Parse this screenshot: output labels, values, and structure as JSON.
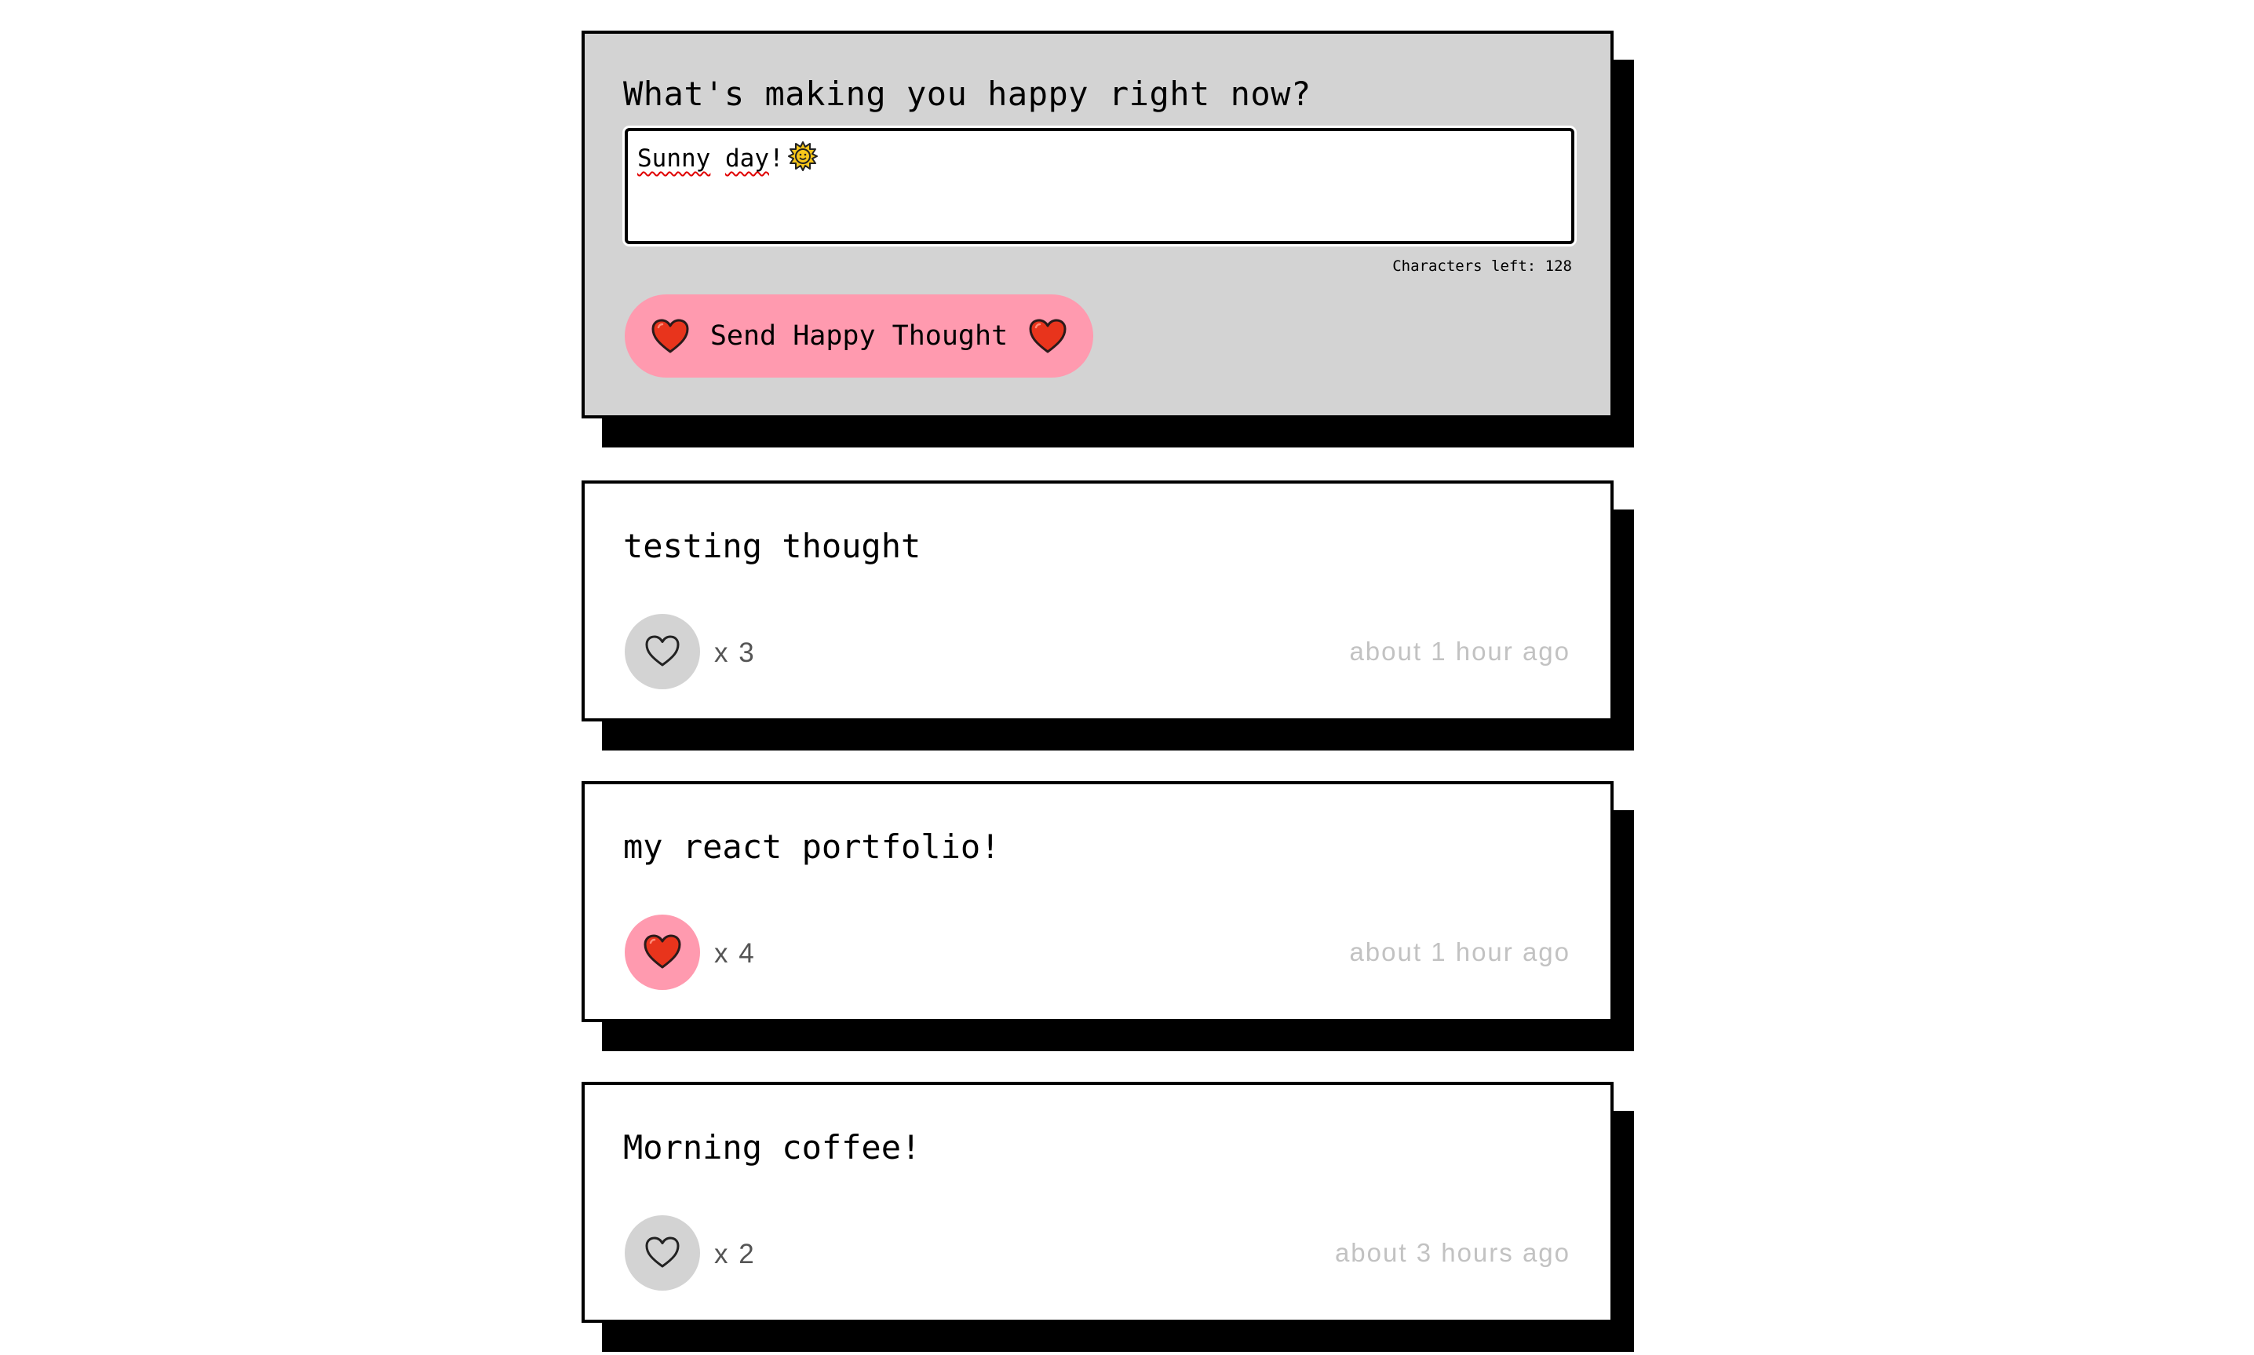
{
  "form": {
    "title": "What's making you happy right now?",
    "input_word1": "Sunny",
    "input_space": " ",
    "input_word2": "day",
    "input_bang": "!",
    "input_emoji_icon": "sun-icon",
    "characters_left_label": "Characters left: 128",
    "send_button_label": "Send Happy Thought",
    "send_button_icon": "heart-icon"
  },
  "thoughts": [
    {
      "message": "testing thought",
      "likes_label": "x 3",
      "likes": 3,
      "liked": false,
      "time": "about 1 hour ago"
    },
    {
      "message": "my react portfolio!",
      "likes_label": "x 4",
      "likes": 4,
      "liked": true,
      "time": "about 1 hour ago"
    },
    {
      "message": "Morning coffee!",
      "likes_label": "x 2",
      "likes": 2,
      "liked": false,
      "time": "about 3 hours ago"
    }
  ],
  "colors": {
    "page_background": "#ffffff",
    "form_background": "#d3d3d3",
    "accent_pink": "#ff9aaf",
    "heart_red": "#e8341c",
    "unliked_button": "#d3d3d3",
    "timestamp_gray": "#c2c2c2",
    "shadow": "#000000"
  }
}
